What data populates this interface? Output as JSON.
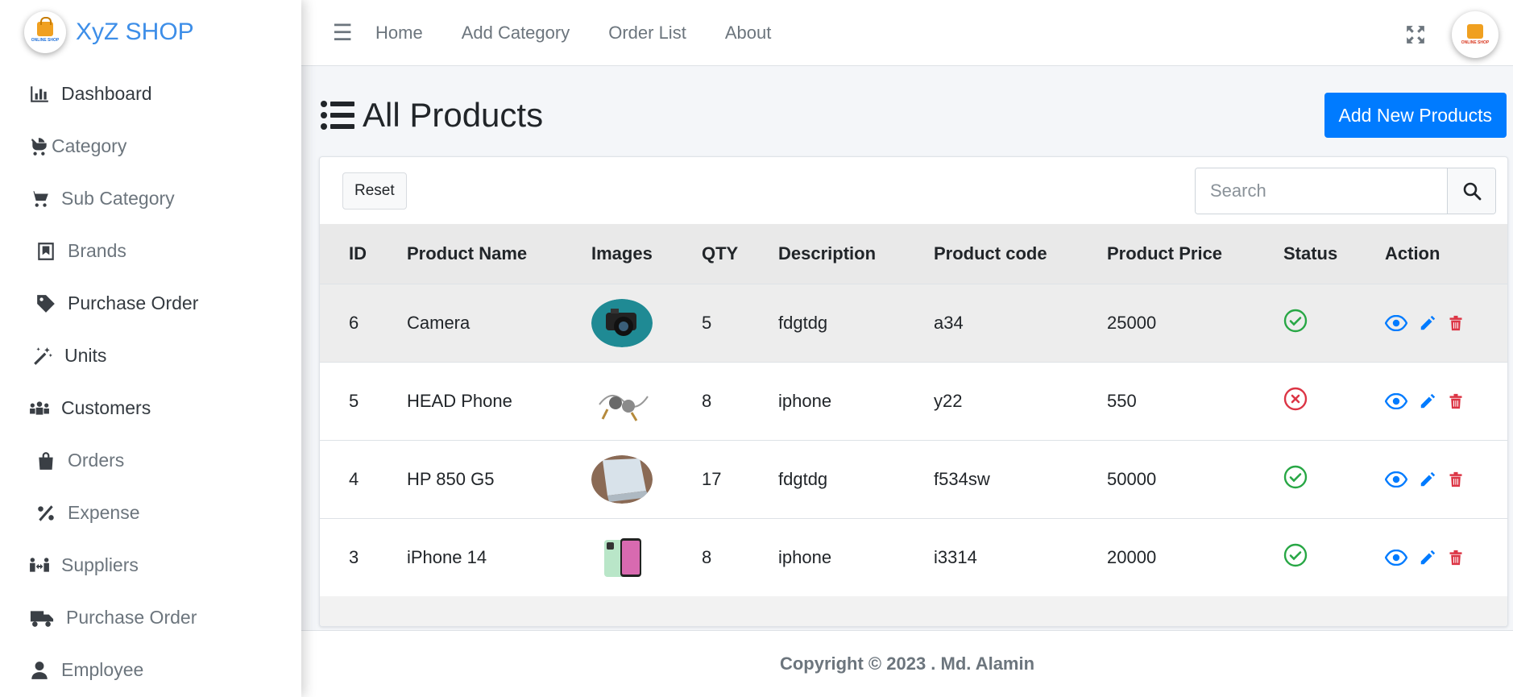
{
  "brand": {
    "name": "XyZ SHOP",
    "logo_text": "ONLINE SHOP"
  },
  "sidebar": {
    "items": [
      {
        "label": "Dashboard",
        "icon": "chart-bar-icon"
      },
      {
        "label": "Category",
        "icon": "baby-carriage-icon"
      },
      {
        "label": "Sub Category",
        "icon": "cart-icon"
      },
      {
        "label": "Brands",
        "icon": "bookmark-icon"
      },
      {
        "label": "Purchase Order",
        "icon": "tag-icon"
      },
      {
        "label": "Units",
        "icon": "magic-wand-icon"
      },
      {
        "label": "Customers",
        "icon": "users-icon"
      },
      {
        "label": "Orders",
        "icon": "shopping-bag-icon"
      },
      {
        "label": "Expense",
        "icon": "percent-icon"
      },
      {
        "label": "Suppliers",
        "icon": "people-arrows-icon"
      },
      {
        "label": "Purchase Order",
        "icon": "truck-icon"
      },
      {
        "label": "Employee",
        "icon": "user-icon"
      }
    ]
  },
  "topbar": {
    "links": [
      "Home",
      "Add Category",
      "Order List",
      "About"
    ]
  },
  "page": {
    "title": "All Products",
    "add_button": "Add New Products",
    "reset_button": "Reset",
    "search_placeholder": "Search"
  },
  "table": {
    "headers": [
      "ID",
      "Product Name",
      "Images",
      "QTY",
      "Description",
      "Product code",
      "Product Price",
      "Status",
      "Action"
    ],
    "rows": [
      {
        "id": "6",
        "name": "Camera",
        "image": "camera",
        "qty": "5",
        "description": "fdgtdg",
        "code": "a34",
        "price": "25000",
        "status": "active"
      },
      {
        "id": "5",
        "name": "HEAD Phone",
        "image": "earphones",
        "qty": "8",
        "description": "iphone",
        "code": "y22",
        "price": "550",
        "status": "inactive"
      },
      {
        "id": "4",
        "name": "HP 850 G5",
        "image": "laptop",
        "qty": "17",
        "description": "fdgtdg",
        "code": "f534sw",
        "price": "50000",
        "status": "active"
      },
      {
        "id": "3",
        "name": "iPhone 14",
        "image": "phone",
        "qty": "8",
        "description": "iphone",
        "code": "i3314",
        "price": "20000",
        "status": "active"
      }
    ]
  },
  "footer": {
    "text": "Copyright © 2023 . Md. Alamin"
  },
  "colors": {
    "primary": "#007bff",
    "success": "#28a745",
    "danger": "#dc3545",
    "brand": "#3d8ee8"
  }
}
